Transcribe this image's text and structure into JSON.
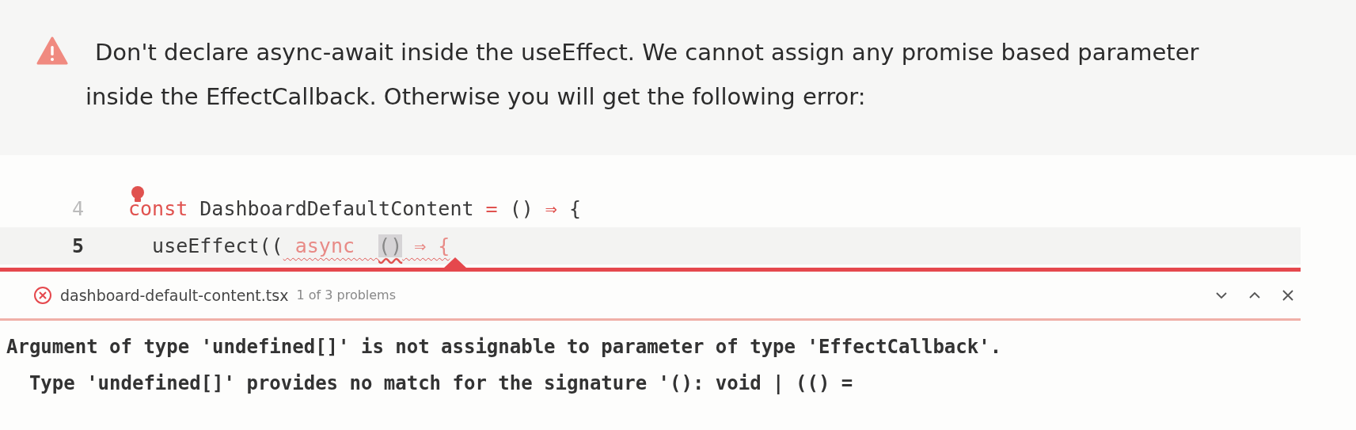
{
  "callout": {
    "kind": "warning",
    "text": "Don't declare async-await inside the useEffect. We cannot assign any promise based parameter inside the EffectCallback. Otherwise you will get the following error:"
  },
  "editor": {
    "lines": [
      {
        "number": "4",
        "selected": false,
        "tokens": [
          {
            "text": "const",
            "kind": "keyword"
          },
          {
            "text": " DashboardDefaultContent ",
            "kind": "plain"
          },
          {
            "text": "=",
            "kind": "keyword"
          },
          {
            "text": " () ",
            "kind": "plain"
          },
          {
            "text": "⇒",
            "kind": "keyword"
          },
          {
            "text": " {",
            "kind": "plain"
          }
        ]
      },
      {
        "number": "5",
        "selected": true,
        "tokens": [
          {
            "text": "  useEffect((",
            "kind": "plain"
          },
          {
            "text": " async  ",
            "kind": "error"
          },
          {
            "text": "()",
            "kind": "highlight"
          },
          {
            "text": " ⇒ {",
            "kind": "error"
          }
        ]
      }
    ]
  },
  "problem_peek": {
    "file": "dashboard-default-content.tsx",
    "count": "1 of 3 problems",
    "messages": [
      "Argument of type 'undefined[]' is not assignable to parameter of type 'EffectCallback'.",
      "  Type 'undefined[]' provides no match for the signature '(): void | (() ="
    ]
  }
}
